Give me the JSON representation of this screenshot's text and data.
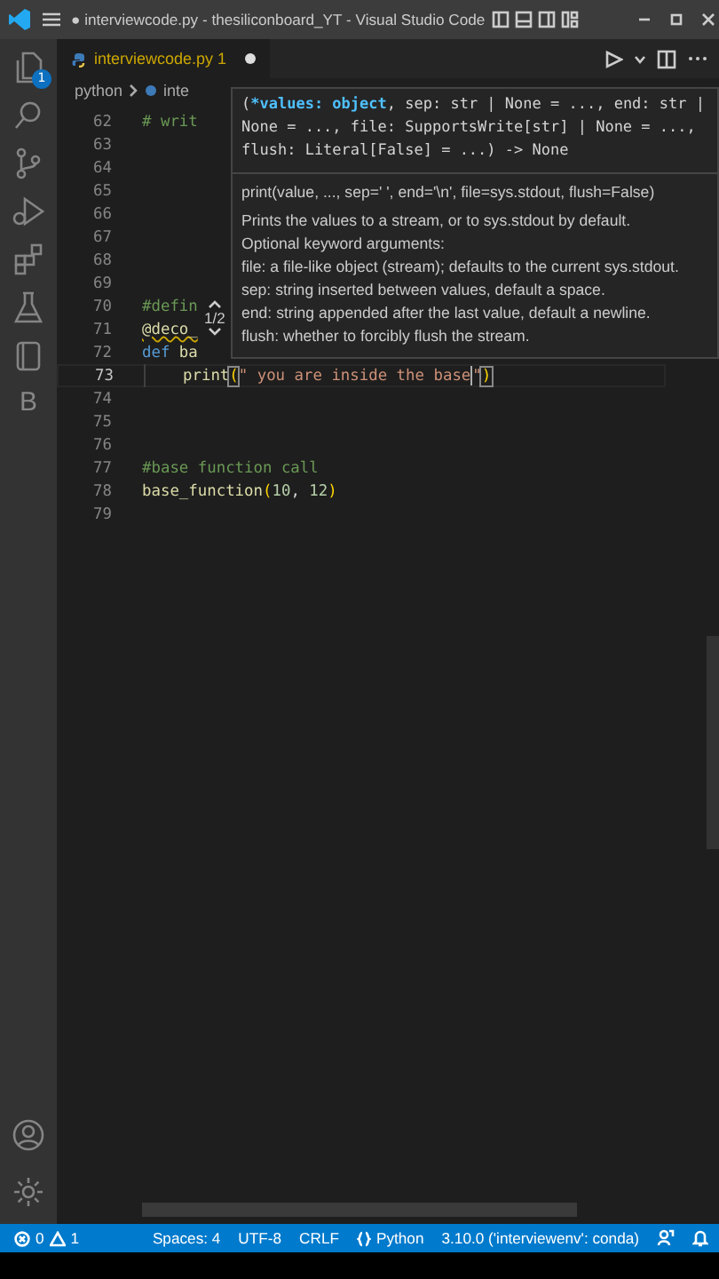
{
  "window": {
    "title": "● interviewcode.py - thesiliconboard_YT - Visual Studio Code"
  },
  "activity_bar": {
    "items": [
      {
        "kind": "files",
        "badge": "1"
      },
      {
        "kind": "search"
      },
      {
        "kind": "source-control"
      },
      {
        "kind": "debug"
      },
      {
        "kind": "extensions"
      },
      {
        "kind": "testing"
      },
      {
        "kind": "notebook"
      },
      {
        "kind": "letter",
        "label": "B"
      }
    ],
    "bottom": [
      {
        "kind": "account"
      },
      {
        "kind": "settings"
      }
    ]
  },
  "tab": {
    "label": "interviewcode.py 1",
    "warning": true,
    "modified": true,
    "selected": true
  },
  "breadcrumb": [
    "python",
    "inte"
  ],
  "editor": {
    "lines": [
      {
        "number": "62",
        "tokens": [
          {
            "kind": "comment",
            "text": "# writ"
          }
        ]
      },
      {
        "number": "63"
      },
      {
        "number": "64"
      },
      {
        "number": "65"
      },
      {
        "number": "66"
      },
      {
        "number": "67"
      },
      {
        "number": "68"
      },
      {
        "number": "69"
      },
      {
        "number": "70",
        "tokens": [
          {
            "kind": "comment",
            "text": "#defin"
          }
        ]
      },
      {
        "number": "71",
        "tokens": [
          {
            "kind": "decorator",
            "text": "@deco_",
            "warning": true
          }
        ]
      },
      {
        "number": "72",
        "tokens": [
          {
            "kind": "keyword",
            "text": "def"
          },
          {
            "kind": "function",
            "text": " ba"
          }
        ]
      },
      {
        "number": "73",
        "current": true,
        "indent": true,
        "tokens": [
          {
            "kind": "function",
            "text": "print"
          },
          {
            "kind": "bracket",
            "text": "("
          },
          {
            "kind": "string",
            "text": "\" you are inside the base"
          },
          {
            "kind": "cursor"
          },
          {
            "kind": "string",
            "text": "\""
          },
          {
            "kind": "bracket",
            "text": ")"
          }
        ]
      },
      {
        "number": "74"
      },
      {
        "number": "75"
      },
      {
        "number": "76"
      },
      {
        "number": "77",
        "tokens": [
          {
            "kind": "comment",
            "text": "#base function call"
          }
        ]
      },
      {
        "number": "78",
        "tokens": [
          {
            "kind": "function",
            "text": "base_function"
          },
          {
            "kind": "paren",
            "text": "("
          },
          {
            "kind": "number",
            "text": "10"
          },
          {
            "kind": "plain",
            "text": ", "
          },
          {
            "kind": "number",
            "text": "12"
          },
          {
            "kind": "paren",
            "text": ")"
          }
        ]
      },
      {
        "number": "79"
      }
    ]
  },
  "hover": {
    "overload": "1/2",
    "signature": [
      [
        {
          "kind": "plain",
          "text": "("
        },
        {
          "kind": "active",
          "text": "*values: object"
        },
        {
          "kind": "plain",
          "text": ", sep: str | None = ..., end: str |"
        }
      ],
      [
        {
          "kind": "plain",
          "text": "None = ..., file: SupportsWrite[str] | None = ...,"
        }
      ],
      [
        {
          "kind": "plain",
          "text": "flush: Literal[False] = ...) -> None"
        }
      ]
    ],
    "summary": "print(value, ..., sep=' ', end='\\n', file=sys.stdout, flush=False)",
    "doc": [
      "Prints the values to a stream, or to sys.stdout by default.",
      "Optional keyword arguments:",
      "file: a file-like object (stream); defaults to the current sys.stdout.",
      "sep: string inserted between values, default a space.",
      "end: string appended after the last value, default a newline.",
      "flush: whether to forcibly flush the stream."
    ]
  },
  "status_bar": {
    "errors": "0",
    "warnings": "1",
    "items": [
      {
        "kind": "text",
        "label": "Spaces: 4"
      },
      {
        "kind": "text",
        "label": "UTF-8"
      },
      {
        "kind": "text",
        "label": "CRLF"
      },
      {
        "kind": "language",
        "label": "Python"
      },
      {
        "kind": "text",
        "label": "3.10.0 ('interviewenv': conda)"
      },
      {
        "kind": "feedback"
      },
      {
        "kind": "bell"
      }
    ]
  }
}
